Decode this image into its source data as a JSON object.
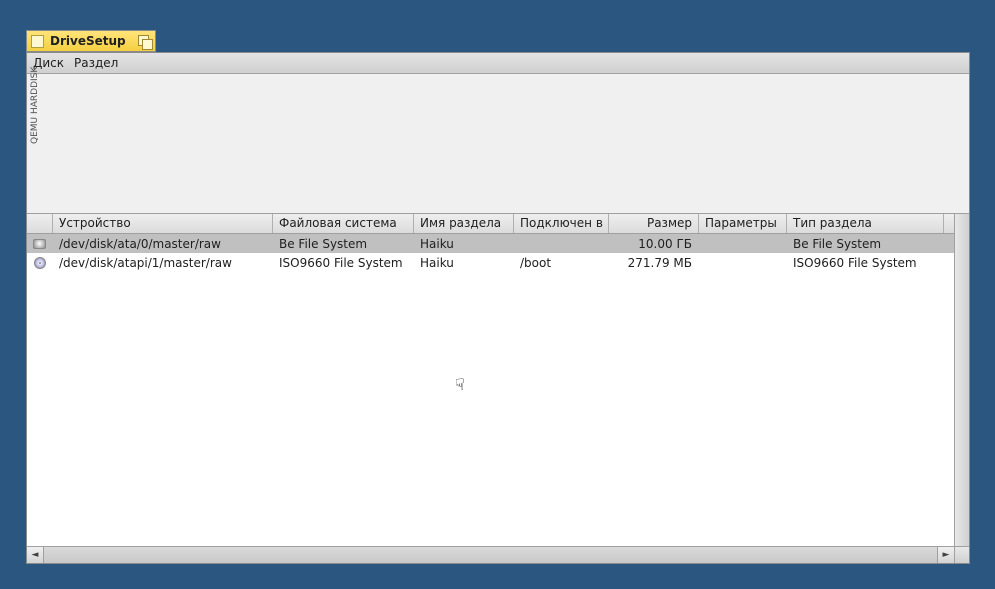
{
  "window": {
    "title": "DriveSetup",
    "disk_label_vertical": "QEMU HARDDISK"
  },
  "menu": {
    "disk": "Диск",
    "partition": "Раздел"
  },
  "columns": {
    "device": "Устройство",
    "filesystem": "Файловая система",
    "volume": "Имя раздела",
    "mounted_at": "Подключен в",
    "size": "Размер",
    "parameters": "Параметры",
    "type": "Тип раздела"
  },
  "rows": [
    {
      "icon": "disk",
      "device": "/dev/disk/ata/0/master/raw",
      "filesystem": "Be File System",
      "volume": "Haiku",
      "mounted_at": "",
      "size": "10.00 ГБ",
      "parameters": "",
      "type": "Be File System",
      "selected": true
    },
    {
      "icon": "cd",
      "device": "/dev/disk/atapi/1/master/raw",
      "filesystem": "ISO9660 File System",
      "volume": "Haiku",
      "mounted_at": "/boot",
      "size": "271.79 МБ",
      "parameters": "",
      "type": "ISO9660 File System",
      "selected": false
    }
  ]
}
